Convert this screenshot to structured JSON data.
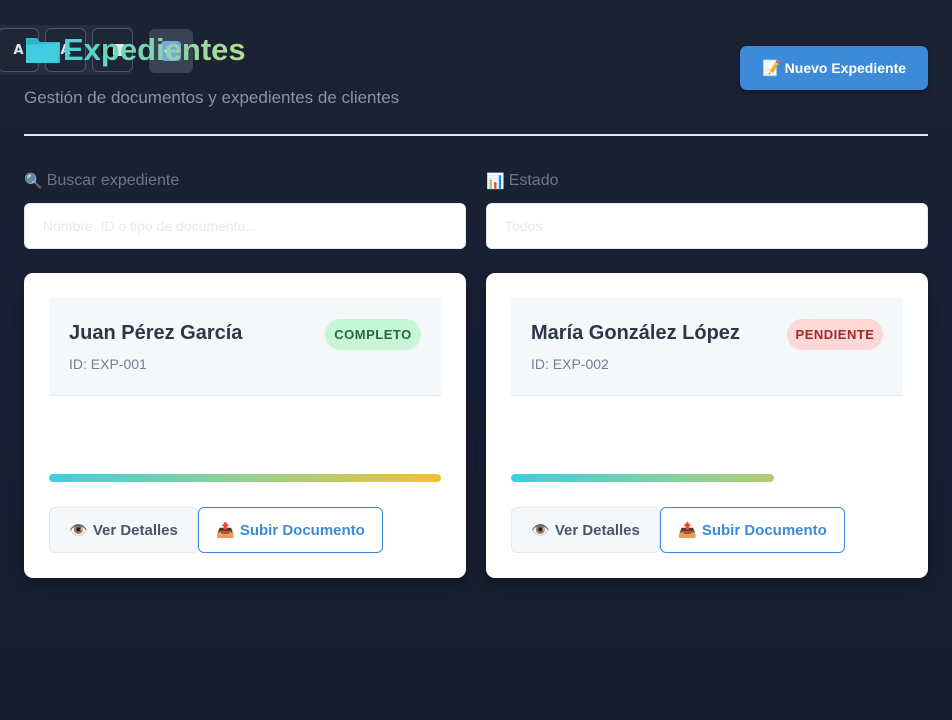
{
  "toolbar": {
    "font_small_label": "A",
    "font_large_label": "A"
  },
  "header": {
    "title": "Expedientes",
    "subtitle": "Gestión de documentos y expedientes de clientes",
    "new_button_icon": "📝",
    "new_button_label": "Nuevo Expediente"
  },
  "filters": {
    "search_icon": "🔍",
    "search_label": "Buscar expediente",
    "search_placeholder": "Nombre, ID o tipo de documento...",
    "status_icon": "📊",
    "status_label": "Estado",
    "status_selected": "Todos"
  },
  "cards": [
    {
      "name": "Juan Pérez García",
      "id": "ID: EXP-001",
      "status": "COMPLETO",
      "progress": 1.0,
      "details_icon": "👁️",
      "details_label": "Ver Detalles",
      "upload_icon": "📤",
      "upload_label": "Subir Documento"
    },
    {
      "name": "María González López",
      "id": "ID: EXP-002",
      "status": "PENDIENTE",
      "progress": 0.67,
      "details_icon": "👁️",
      "details_label": "Ver Detalles",
      "upload_icon": "📤",
      "upload_label": "Subir Documento"
    }
  ],
  "colors": {
    "accent": "#3d8bd8",
    "complete_badge_bg": "#c6f6d5",
    "pending_badge_bg": "#fed7d7"
  }
}
